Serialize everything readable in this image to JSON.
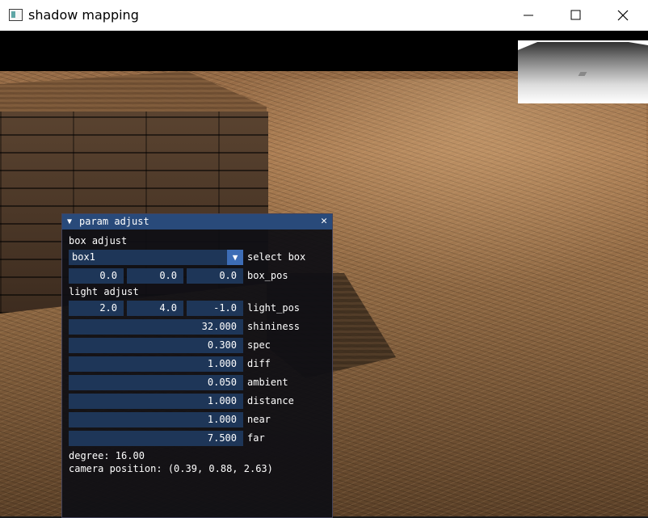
{
  "window": {
    "title": "shadow mapping"
  },
  "panel": {
    "title": "param adjust",
    "box_adjust_label": "box adjust",
    "select_box": {
      "value": "box1",
      "label": "select box"
    },
    "box_pos": {
      "values": [
        "0.0",
        "0.0",
        "0.0"
      ],
      "label": "box_pos"
    },
    "light_adjust_label": "light adjust",
    "light_pos": {
      "values": [
        "2.0",
        "4.0",
        "-1.0"
      ],
      "label": "light_pos"
    },
    "params": [
      {
        "value": "32.000",
        "label": "shininess"
      },
      {
        "value": "0.300",
        "label": "spec"
      },
      {
        "value": "1.000",
        "label": "diff"
      },
      {
        "value": "0.050",
        "label": "ambient"
      },
      {
        "value": "1.000",
        "label": "distance"
      },
      {
        "value": "1.000",
        "label": "near"
      },
      {
        "value": "7.500",
        "label": "far"
      }
    ],
    "degree": "degree: 16.00",
    "camera_position": "camera position: (0.39, 0.88, 2.63)"
  },
  "colors": {
    "header": "#294a7a",
    "field": "#1e3658",
    "accent": "#3d6db6"
  }
}
